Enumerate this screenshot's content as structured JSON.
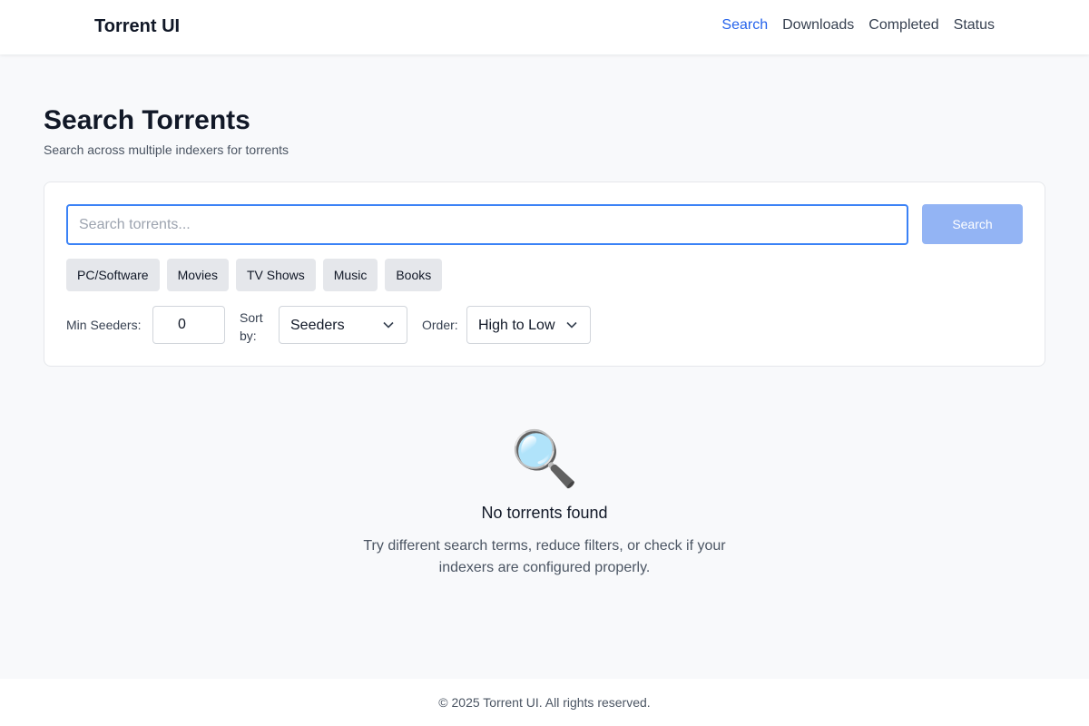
{
  "nav": {
    "brand": "Torrent UI",
    "links": [
      {
        "label": "Search",
        "active": true
      },
      {
        "label": "Downloads",
        "active": false
      },
      {
        "label": "Completed",
        "active": false
      },
      {
        "label": "Status",
        "active": false
      }
    ]
  },
  "page": {
    "title": "Search Torrents",
    "subtitle": "Search across multiple indexers for torrents"
  },
  "search": {
    "placeholder": "Search torrents...",
    "value": "",
    "button_label": "Search"
  },
  "categories": [
    "PC/Software",
    "Movies",
    "TV Shows",
    "Music",
    "Books"
  ],
  "filters": {
    "min_seeders_label": "Min Seeders:",
    "min_seeders_value": "0",
    "sort_by_label": "Sort by:",
    "sort_by_value": "Seeders",
    "order_label": "Order:",
    "order_value": "High to Low"
  },
  "empty_state": {
    "icon": "magnifying-glass-icon",
    "icon_glyph": "🔍",
    "title": "No torrents found",
    "description": "Try different search terms, reduce filters, or check if your indexers are configured properly."
  },
  "footer": {
    "text": "© 2025 Torrent UI. All rights reserved."
  },
  "colors": {
    "accent": "#2563eb",
    "search_button": "#93b4f4",
    "chip_bg": "#e5e7eb"
  }
}
